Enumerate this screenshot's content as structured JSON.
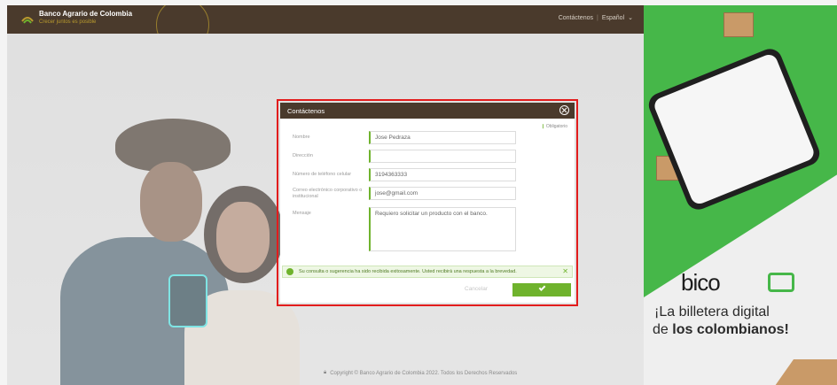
{
  "header": {
    "brand": "Banco Agrario de Colombia",
    "slogan": "Crecer juntos es posible",
    "nav_contact": "Contáctenos",
    "nav_separator": "|",
    "nav_language": "Español",
    "chevron_icon": "chevron-down-icon"
  },
  "modal": {
    "title": "Contáctenos",
    "required_note": "Obligatorio",
    "fields": [
      {
        "label": "Nombre",
        "value": "Jose Pedraza"
      },
      {
        "label": "Dirección",
        "value": ""
      },
      {
        "label": "Número de teléfono celular",
        "value": "3194363333"
      },
      {
        "label": "Correo electrónico corporativo o institucional",
        "value": "jose@gmail.com"
      },
      {
        "label": "Mensaje",
        "value": "Requiero solicitar un producto con el banco."
      }
    ],
    "success_message": "Su consulta o sugerencia ha sido recibida exitosamente. Usted recibirá una respuesta a la brevedad.",
    "success_close": "✕",
    "cancel_label": "Cancelar"
  },
  "footer": {
    "copyright": "Copyright © Banco Agrario de Colombia 2022. Todos los Derechos Reservados"
  },
  "ad": {
    "logo_text": "bico",
    "line1": "¡La billetera digital",
    "line2_prefix": "de ",
    "line2_bold": "los colombianos!"
  },
  "colors": {
    "header_brown": "#4a3a2c",
    "accent_green": "#6fb32d",
    "highlight_red": "#e21c1c"
  }
}
